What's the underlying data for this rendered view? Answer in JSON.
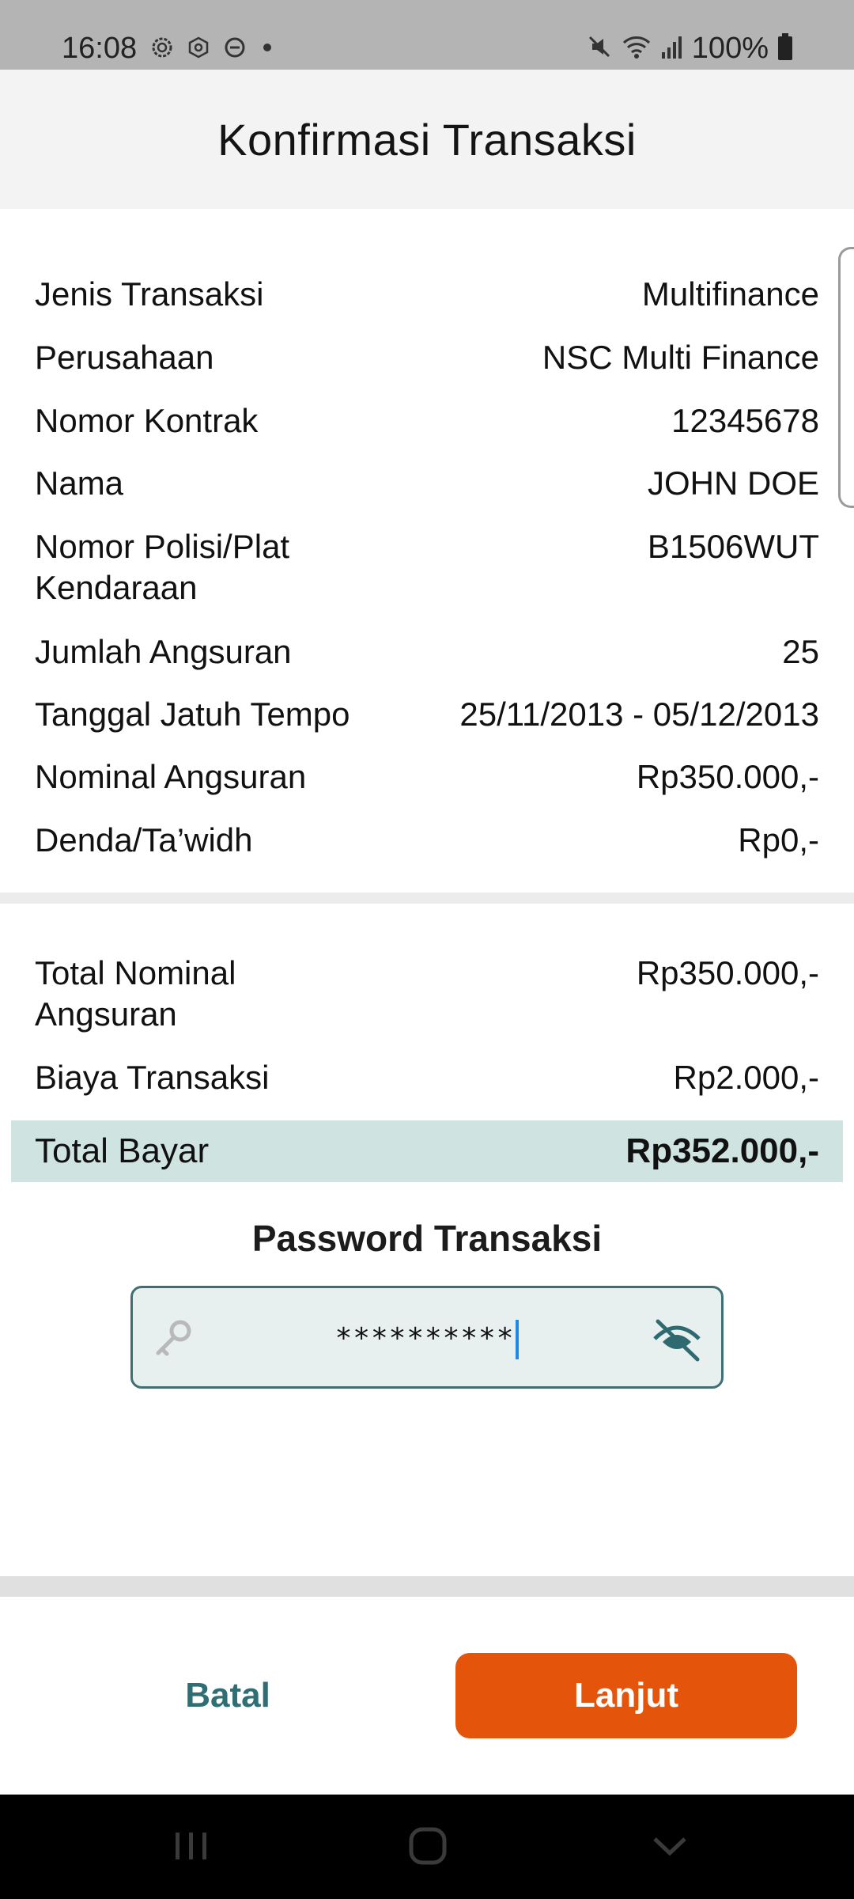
{
  "status_bar": {
    "time": "16:08",
    "battery": "100%",
    "left_icons": [
      "settings-gear-icon",
      "gear-outline-icon",
      "do-not-disturb-icon",
      "dot-icon"
    ],
    "right_icons": [
      "mute-icon",
      "wifi-icon",
      "signal-icon",
      "battery-icon"
    ]
  },
  "header": {
    "title": "Konfirmasi Transaksi"
  },
  "details": [
    {
      "label": "Jenis Transaksi",
      "value": "Multifinance"
    },
    {
      "label": "Perusahaan",
      "value": "NSC Multi Finance"
    },
    {
      "label": "Nomor Kontrak",
      "value": "12345678"
    },
    {
      "label": "Nama",
      "value": "JOHN DOE"
    },
    {
      "label": "Nomor Polisi/Plat Kendaraan",
      "value": "B1506WUT"
    },
    {
      "label": "Jumlah Angsuran",
      "value": "25"
    },
    {
      "label": "Tanggal Jatuh Tempo",
      "value": "25/11/2013 - 05/12/2013"
    },
    {
      "label": "Nominal Angsuran",
      "value": "Rp350.000,-"
    },
    {
      "label": "Denda/Ta’widh",
      "value": "Rp0,-"
    }
  ],
  "summary": [
    {
      "label": "Total Nominal Angsuran",
      "value": "Rp350.000,-"
    },
    {
      "label": "Biaya Transaksi",
      "value": "Rp2.000,-"
    }
  ],
  "total": {
    "label": "Total Bayar",
    "value": "Rp352.000,-"
  },
  "password": {
    "label": "Password Transaksi",
    "value": "**********"
  },
  "buttons": {
    "cancel": "Batal",
    "next": "Lanjut"
  },
  "colors": {
    "accent_orange": "#e4540b",
    "teal_text": "#2e6e74",
    "total_highlight": "#cfe3e1"
  }
}
